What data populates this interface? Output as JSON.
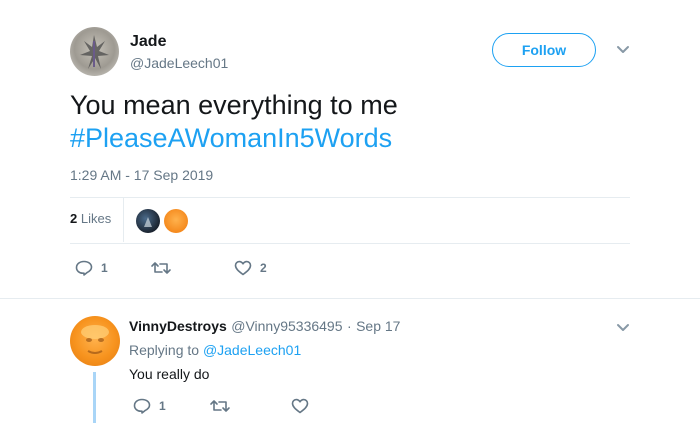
{
  "tweet": {
    "author_name": "Jade",
    "author_handle": "@JadeLeech01",
    "follow_label": "Follow",
    "text_line": "You mean everything to me",
    "hashtag": "#PleaseAWomanIn5Words",
    "timestamp": "1:29 AM - 17 Sep 2019",
    "likes_count": "2",
    "likes_label": "Likes",
    "reply_count": "1",
    "like_count": "2"
  },
  "reply": {
    "author_name": "VinnyDestroys",
    "author_handle": "@Vinny95336495",
    "separator": "·",
    "date": "Sep 17",
    "replying_prefix": "Replying to",
    "replying_to": "@JadeLeech01",
    "text": "You really do",
    "reply_count": "1"
  },
  "icons": {
    "reply": "reply-icon",
    "retweet": "retweet-icon",
    "like": "heart-icon",
    "menu": "chevron-down-icon"
  },
  "colors": {
    "accent": "#1da1f2",
    "muted": "#657786",
    "thread_line": "#a9d5f7"
  }
}
